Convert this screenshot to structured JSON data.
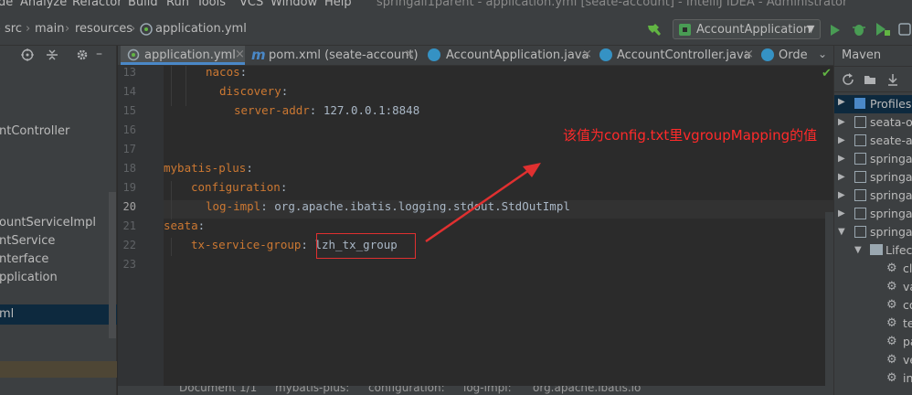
{
  "menu": {
    "items": [
      "de",
      "Analyze",
      "Refactor",
      "Build",
      "Run",
      "Tools",
      "VCS",
      "Window",
      "Help"
    ],
    "window_title": "springall1parent - application.yml [seate-account] - IntelliJ IDEA - Administrator"
  },
  "breadcrumb": {
    "items": [
      "src",
      "main",
      "resources",
      "application.yml"
    ]
  },
  "run_config": {
    "label": "AccountApplication"
  },
  "project_tree": {
    "items": [
      "ntController",
      "ountServiceImpl",
      "ntService",
      "nterface",
      "pplication",
      "ml"
    ]
  },
  "tabs": [
    {
      "label": "application.yml"
    },
    {
      "label": "pom.xml (seate-account)"
    },
    {
      "label": "AccountApplication.java"
    },
    {
      "label": "AccountController.java"
    },
    {
      "label": "Orde"
    }
  ],
  "editor": {
    "line_numbers": [
      "13",
      "14",
      "15",
      "16",
      "17",
      "18",
      "19",
      "20",
      "21",
      "22",
      "23"
    ],
    "lines": {
      "l13_key": "nacos",
      "l14_key": "discovery",
      "l15_key": "server-addr",
      "l15_val": "127.0.0.1:8848",
      "l18_key": "mybatis-plus",
      "l19_key": "configuration",
      "l20_key": "log-impl",
      "l20_val": "org.apache.ibatis.logging.stdout.StdOutImpl",
      "l21_key": "seata",
      "l22_key": "tx-service-group",
      "l22_val": "lzh_tx_group"
    },
    "colon": ":"
  },
  "annotation": {
    "note": "该值为config.txt里vgroupMapping的值"
  },
  "maven": {
    "title": "Maven",
    "items": [
      "Profiles",
      "seata-or",
      "seate-ac",
      "springal",
      "springal",
      "springal",
      "springal",
      "springal",
      "Lifecy",
      "cl",
      "va",
      "co",
      "te",
      "pa",
      "ve",
      "in"
    ]
  },
  "status": {
    "crumbs": [
      "Document 1/1",
      "mybatis-plus:",
      "configuration:",
      "log-impl:",
      "org.apache.ibatis.lo"
    ]
  },
  "colors": {
    "accent": "#4a88c7",
    "annotation_red": "#e03030",
    "yaml_key": "#cc7832"
  }
}
